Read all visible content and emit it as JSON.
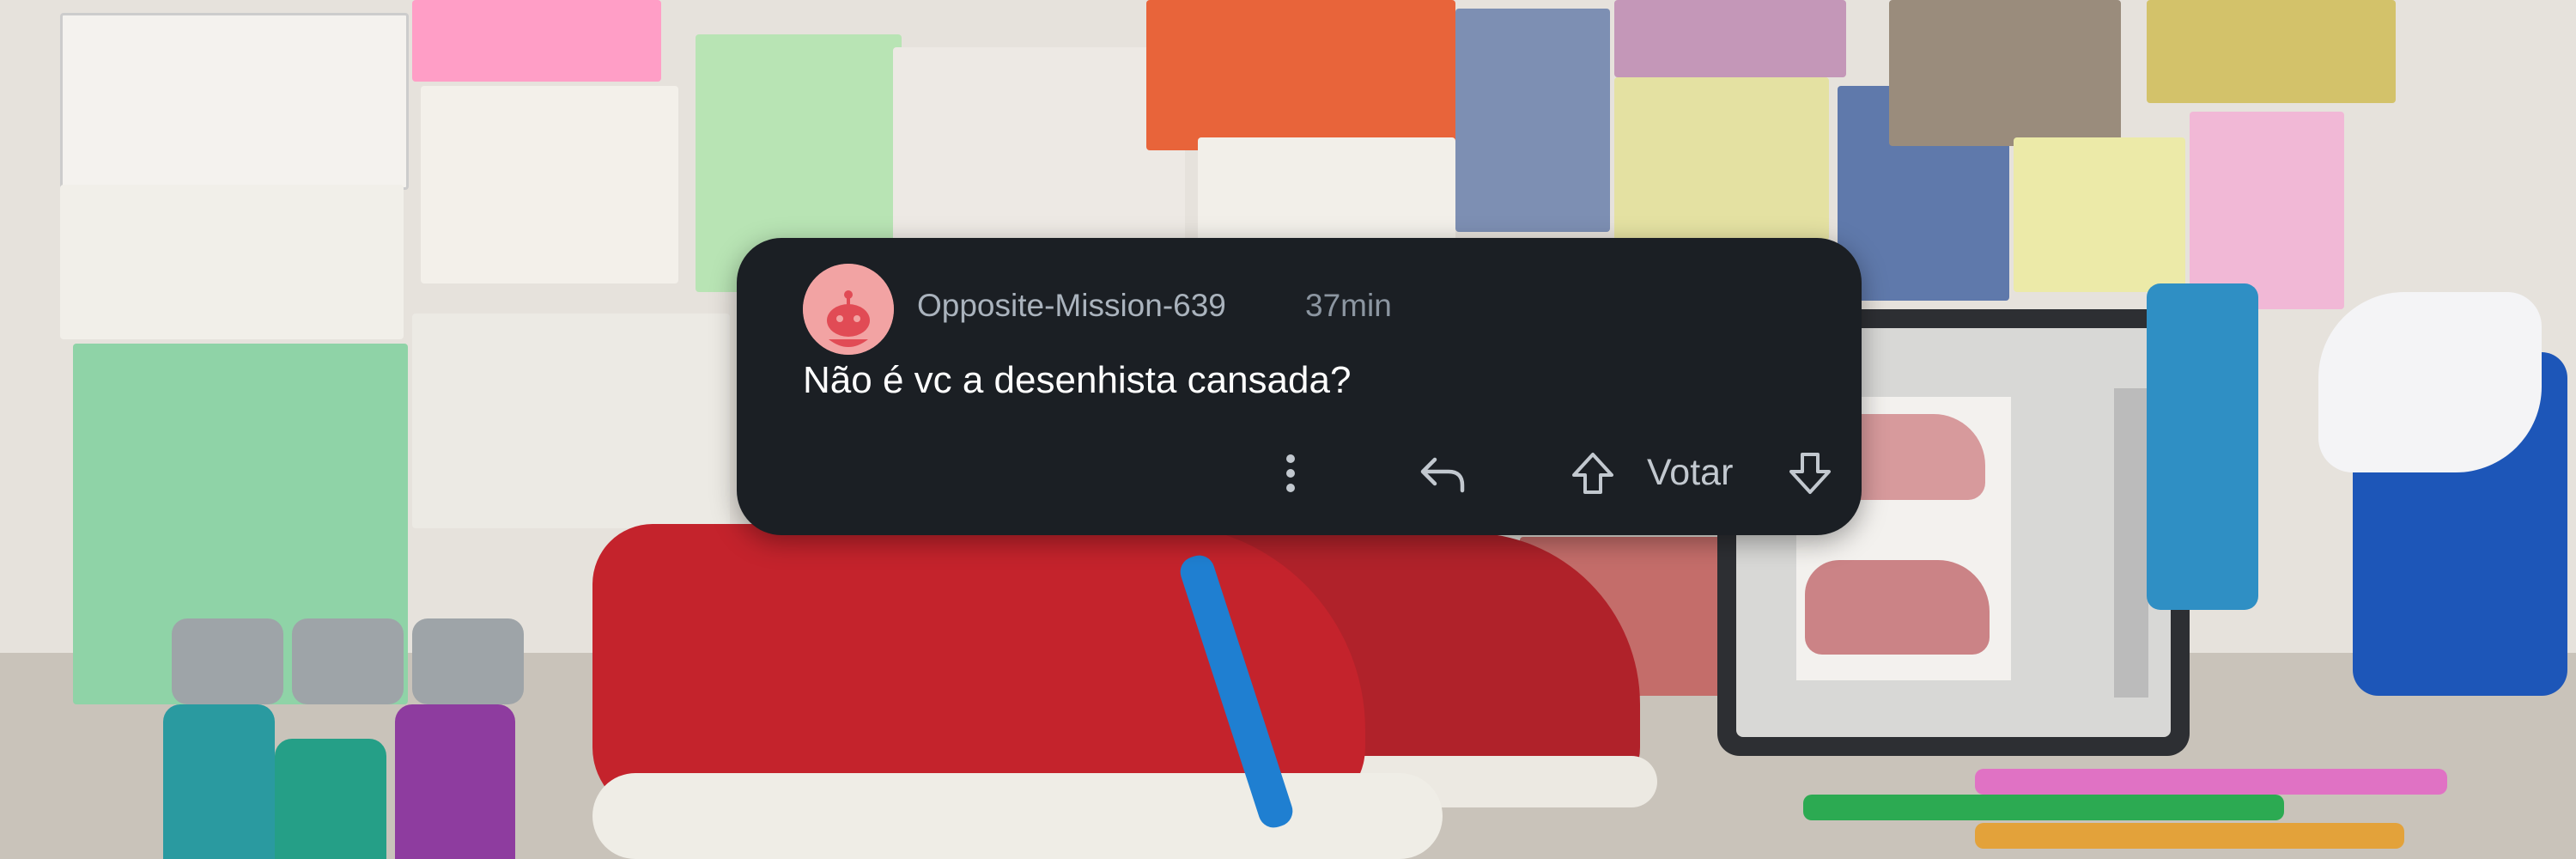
{
  "comment": {
    "username": "Opposite-Mission-639",
    "timestamp": "37min",
    "text": "Não é vc a desenhista cansada?",
    "avatar_icon": "reddit-snoo-icon",
    "avatar_color": "#f2a3a3"
  },
  "actions": {
    "more_icon": "more-vertical-icon",
    "reply_icon": "reply-arrow-icon",
    "upvote_icon": "arrow-up-icon",
    "vote_label": "Votar",
    "downvote_icon": "arrow-down-icon"
  },
  "colors": {
    "card_background": "#1b1f24",
    "text_primary": "#ffffff",
    "text_secondary": "#aab3bd"
  }
}
